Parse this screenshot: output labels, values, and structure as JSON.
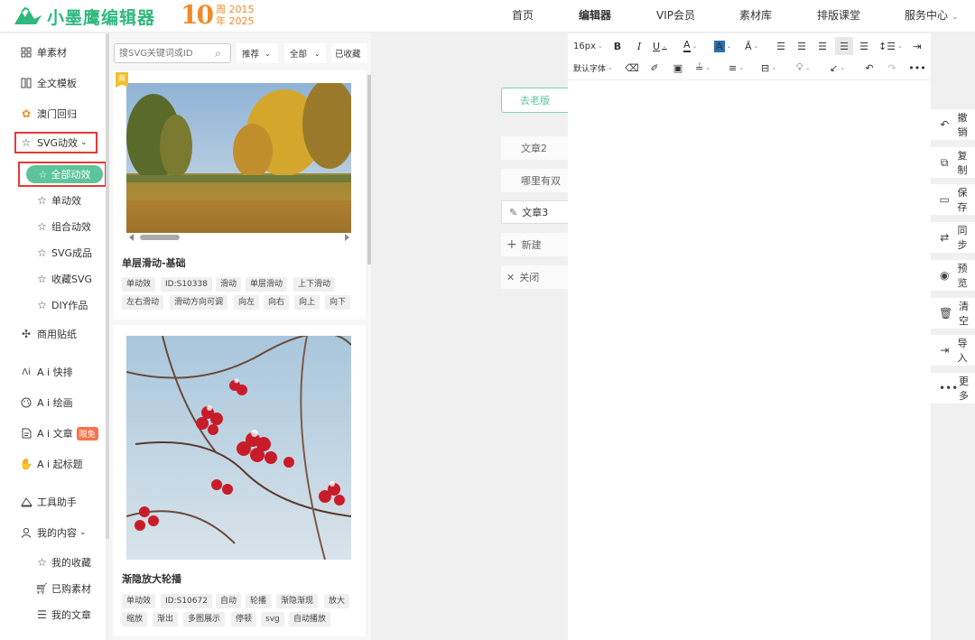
{
  "header": {
    "logo_text": "小墨鹰编辑器",
    "anniversary_num": "10",
    "anniversary_line1": "周 2015",
    "anniversary_line2": "年 2025",
    "nav": [
      {
        "label": "首页"
      },
      {
        "label": "编辑器"
      },
      {
        "label": "VIP会员"
      },
      {
        "label": "素材库"
      },
      {
        "label": "排版课堂"
      },
      {
        "label": "服务中心"
      }
    ]
  },
  "sidebar": {
    "items": [
      {
        "label": "单素材",
        "icon": "grid-icon"
      },
      {
        "label": "全文模板",
        "icon": "template-icon"
      },
      {
        "label": "澳门回归",
        "icon": "flower-icon"
      },
      {
        "label": "SVG动效",
        "icon": "star-icon"
      },
      {
        "label": "商用贴纸",
        "icon": "sticker-icon"
      },
      {
        "label": "A i 快排",
        "icon": "ai-icon"
      },
      {
        "label": "A i 绘画",
        "icon": "palette-icon"
      },
      {
        "label": "A i 文章",
        "icon": "doc-icon",
        "badge": "限免"
      },
      {
        "label": "A i 起标题",
        "icon": "hand-icon"
      },
      {
        "label": "工具助手",
        "icon": "tool-icon"
      },
      {
        "label": "我的内容",
        "icon": "user-icon"
      }
    ],
    "svg_sub": [
      {
        "label": "全部动效"
      },
      {
        "label": "单动效"
      },
      {
        "label": "组合动效"
      },
      {
        "label": "SVG成品"
      },
      {
        "label": "收藏SVG"
      },
      {
        "label": "DIY作品"
      }
    ],
    "my_sub": [
      {
        "label": "我的收藏"
      },
      {
        "label": "已购素材"
      },
      {
        "label": "我的文章"
      }
    ]
  },
  "materials": {
    "search_placeholder": "搜SVG关键词或ID",
    "filter_sort": "推荐",
    "filter_all": "全部",
    "filter_collected": "已收藏",
    "ribbon": "商",
    "cards": [
      {
        "title": "单层滑动-基础",
        "tags": [
          "单动效",
          "ID:S10338",
          "滑动",
          "单层滑动",
          "上下滑动",
          "左右滑动",
          "滑动方向可调",
          "向左",
          "向右",
          "向上",
          "向下"
        ]
      },
      {
        "title": "渐隐放大轮播",
        "tags": [
          "单动效",
          "ID:S10672",
          "自动",
          "轮播",
          "渐隐渐现",
          "放大",
          "缩放",
          "渐出",
          "多图展示",
          "停顿",
          "svg",
          "自动播放"
        ]
      }
    ]
  },
  "articles": {
    "old_version": "去老版",
    "items": [
      {
        "label": "文章2"
      },
      {
        "label": "哪里有双"
      },
      {
        "label": "文章3"
      },
      {
        "label": "新建"
      },
      {
        "label": "关闭"
      }
    ]
  },
  "toolbar": {
    "font_size": "16px",
    "font_family": "默认字体"
  },
  "right_panel": {
    "items": [
      {
        "label": "撤销"
      },
      {
        "label": "复制"
      },
      {
        "label": "保存"
      },
      {
        "label": "同步"
      },
      {
        "label": "预览"
      },
      {
        "label": "清空"
      },
      {
        "label": "导入"
      },
      {
        "label": "更多"
      }
    ]
  },
  "colors": {
    "brand": "#2db87d",
    "accent": "#5cc39b",
    "anniversary": "#f08a28",
    "highlight_box": "#e53935"
  }
}
